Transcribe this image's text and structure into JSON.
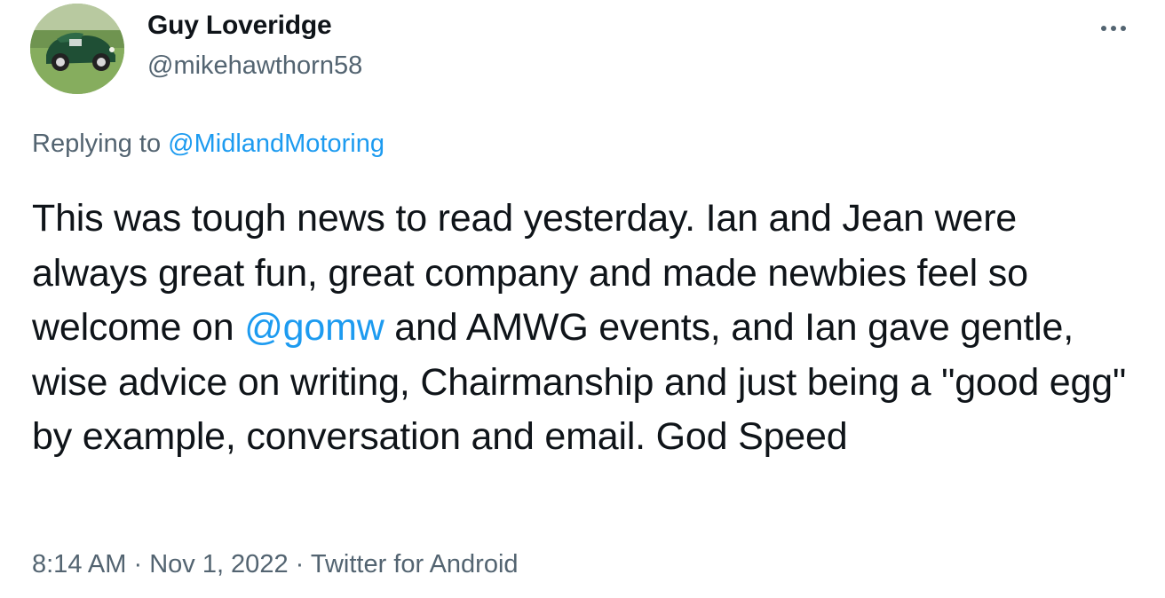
{
  "author": {
    "display_name": "Guy Loveridge",
    "handle": "@mikehawthorn58",
    "avatar": "green-vintage-roadster-photo"
  },
  "more_icon": "more-horizontal-icon",
  "reply": {
    "prefix": "Replying to ",
    "to": "@MidlandMotoring"
  },
  "tweet": {
    "part1": "This was tough news to read yesterday. Ian and Jean were always great fun, great company and made newbies feel so welcome on ",
    "mention": "@gomw",
    "part2": " and AMWG events, and Ian gave gentle, wise advice on writing, Chairmanship and just being a \"good egg\" by example, conversation and email. God Speed"
  },
  "meta": {
    "time": "8:14 AM",
    "sep1": " · ",
    "date": "Nov 1, 2022",
    "sep2": " · ",
    "source": "Twitter for Android"
  },
  "colors": {
    "text": "#0f1419",
    "secondary": "#536471",
    "link": "#1d9bf0"
  }
}
